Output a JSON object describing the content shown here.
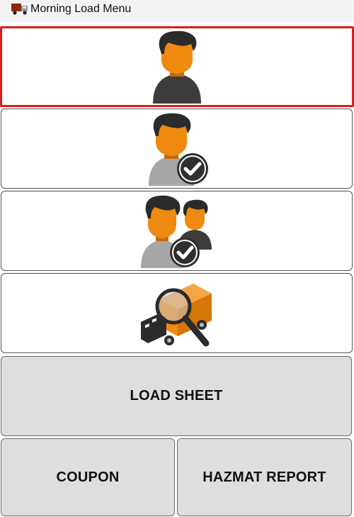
{
  "window": {
    "title": "Morning Load Menu",
    "app_icon": "truck-icon"
  },
  "menu": {
    "items": [
      {
        "icon": "driver-icon",
        "selected": true
      },
      {
        "icon": "driver-check-icon",
        "selected": false
      },
      {
        "icon": "team-check-icon",
        "selected": false
      },
      {
        "icon": "truck-inspect-icon",
        "selected": false
      }
    ]
  },
  "buttons": {
    "load_sheet": "LOAD SHEET",
    "coupon": "COUPON",
    "hazmat_report": "HAZMAT REPORT"
  },
  "colors": {
    "accent_orange": "#ef8a10",
    "selection_border": "#e01b1b",
    "button_bg": "#dedede"
  }
}
